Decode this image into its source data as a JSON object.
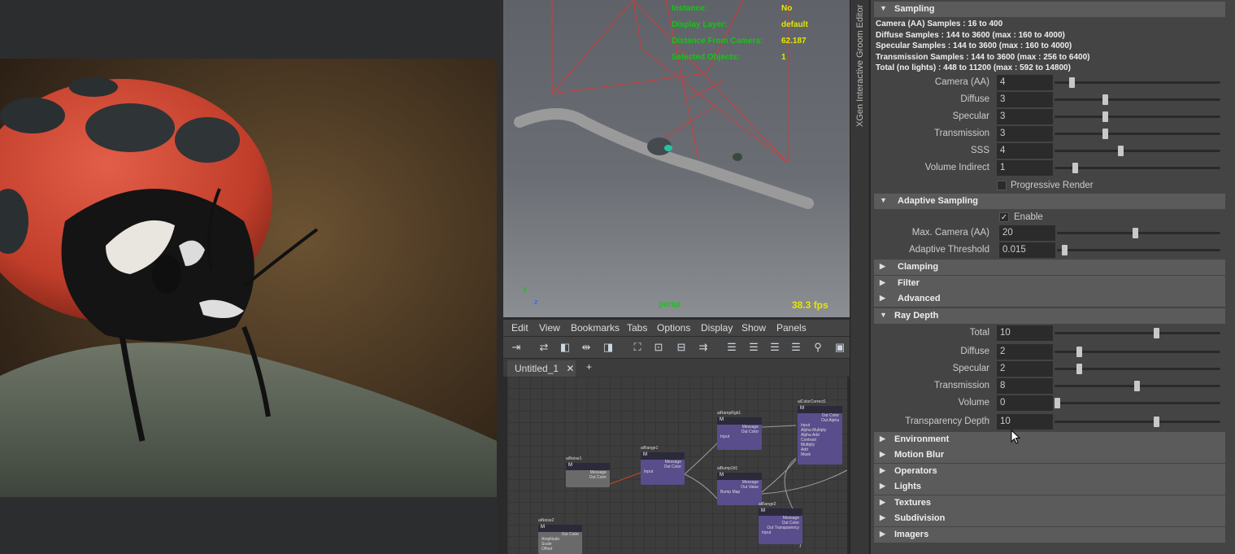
{
  "hud": {
    "rows": [
      {
        "key": "Instance:",
        "value": "No"
      },
      {
        "key": "Display Layer:",
        "value": "default"
      },
      {
        "key": "Distance From Camera:",
        "value": "62.187"
      },
      {
        "key": "Selected Objects:",
        "value": "1"
      }
    ],
    "camera": "persp",
    "fps": "38.3 fps",
    "axis_y": "y",
    "axis_z": "z"
  },
  "hypershade": {
    "menu": [
      "Edit",
      "View",
      "Bookmarks",
      "Tabs",
      "Options",
      "Display",
      "Show",
      "Panels"
    ],
    "tab_label": "Untitled_1",
    "tab_close": "✕",
    "add_tab": "+",
    "nodes": [
      {
        "title": "aiNoise1",
        "header": "M",
        "lines": [
          "Message",
          "Out Color"
        ]
      },
      {
        "title": "aiRange1",
        "header": "M",
        "lines": [
          "Message",
          "Out Color"
        ],
        "inputs": [
          "Input"
        ]
      },
      {
        "title": "aiRampRgb1",
        "header": "M",
        "lines": [
          "Message",
          "Out Color"
        ],
        "inputs": [
          "Input"
        ]
      },
      {
        "title": "aiBump2d1",
        "header": "M",
        "lines": [
          "Message",
          "Out Value"
        ],
        "inputs": [
          "Bump Map"
        ]
      },
      {
        "title": "aiColorCorrect1",
        "header": "M",
        "lines": [
          "Out Color",
          "Out Alpha"
        ],
        "inputs": [
          "Input",
          "Alpha Multiply",
          "Alpha Add",
          "Contrast",
          "Multiply",
          "Add",
          "Mask"
        ]
      },
      {
        "title": "aiRange2",
        "header": "M",
        "lines": [
          "Message",
          "Out Color",
          "Out Transparency"
        ],
        "inputs": [
          "Input"
        ]
      },
      {
        "title": "aiNoise2",
        "header": "M",
        "lines": [
          "Out Color"
        ],
        "inputs": [
          "Amplitude",
          "Scale",
          "Offset"
        ]
      }
    ]
  },
  "xgen_label": "XGen Interactive Groom Editor",
  "attributes": {
    "sampling": {
      "title": "Sampling",
      "info": [
        "Camera (AA) Samples : 16 to 400",
        "Diffuse Samples : 144 to 3600 (max : 160 to 4000)",
        "Specular Samples : 144 to 3600 (max : 160 to 4000)",
        "Transmission Samples : 144 to 3600 (max : 256 to 6400)",
        "Total (no lights) : 448 to 11200 (max : 592 to 14800)"
      ],
      "fields": [
        {
          "label": "Camera (AA)",
          "value": "4",
          "slider": 0.09
        },
        {
          "label": "Diffuse",
          "value": "3",
          "slider": 0.3
        },
        {
          "label": "Specular",
          "value": "3",
          "slider": 0.3
        },
        {
          "label": "Transmission",
          "value": "3",
          "slider": 0.3
        },
        {
          "label": "SSS",
          "value": "4",
          "slider": 0.4
        },
        {
          "label": "Volume Indirect",
          "value": "1",
          "slider": 0.11
        }
      ],
      "progressive_render": "Progressive Render",
      "progressive_checked": false
    },
    "adaptive": {
      "title": "Adaptive Sampling",
      "enable_label": "Enable",
      "enable_checked": true,
      "fields": [
        {
          "label": "Max. Camera (AA)",
          "value": "20",
          "slider": 0.48
        },
        {
          "label": "Adaptive Threshold",
          "value": "0.015",
          "slider": 0.03
        }
      ]
    },
    "collapsed_top": [
      "Clamping",
      "Filter",
      "Advanced"
    ],
    "ray_depth": {
      "title": "Ray Depth",
      "fields": [
        {
          "label": "Total",
          "value": "10",
          "slider": 0.62
        },
        {
          "label": "Diffuse",
          "value": "2",
          "slider": 0.14
        },
        {
          "label": "Specular",
          "value": "2",
          "slider": 0.14
        },
        {
          "label": "Transmission",
          "value": "8",
          "slider": 0.5
        },
        {
          "label": "Volume",
          "value": "0",
          "slider": 0.0
        },
        {
          "label": "Transparency Depth",
          "value": "10",
          "slider": 0.62
        }
      ]
    },
    "collapsed_bottom": [
      "Environment",
      "Motion Blur",
      "Operators",
      "Lights",
      "Textures",
      "Subdivision",
      "Imagers"
    ]
  }
}
